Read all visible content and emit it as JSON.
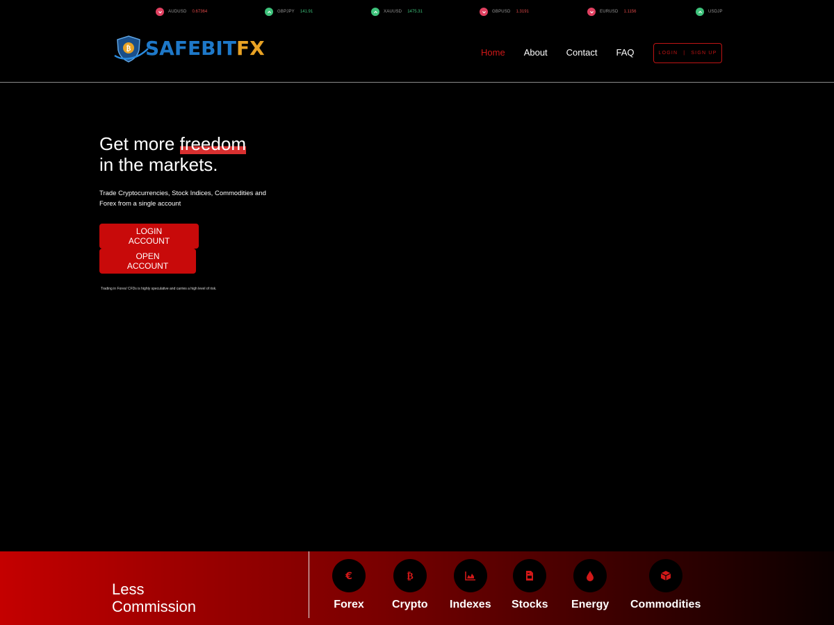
{
  "ticker": [
    {
      "symbol": "AUDUSD",
      "value": "0.67364",
      "direction": "down"
    },
    {
      "symbol": "GBPJPY",
      "value": "141.91",
      "direction": "up"
    },
    {
      "symbol": "XAUUSD",
      "value": "1475.31",
      "direction": "up"
    },
    {
      "symbol": "GBPUSD",
      "value": "1.3191",
      "direction": "down"
    },
    {
      "symbol": "EURUSD",
      "value": "1.1156",
      "direction": "down"
    },
    {
      "symbol": "USDJP",
      "value": "",
      "direction": "up"
    }
  ],
  "header": {
    "logo_part1": "SAFEBIT",
    "logo_part2": "FX",
    "nav": [
      {
        "label": "Home",
        "active": true
      },
      {
        "label": "About",
        "active": false
      },
      {
        "label": "Contact",
        "active": false
      },
      {
        "label": "FAQ",
        "active": false
      }
    ],
    "login_label": "LOGIN",
    "separator": "|",
    "signup_label": "SIGN UP"
  },
  "hero": {
    "title_part1": "Get more ",
    "title_highlight": "freedom",
    "title_part2": "in the markets.",
    "subtitle": "Trade Cryptocurrencies, Stock Indices, Commodities and Forex from a single account",
    "login_button": "LOGIN ACCOUNT",
    "open_button": "OPEN ACCOUNT",
    "disclaimer": "Trading in Forex/ CFDs is highly speculative and carries a high level of risk."
  },
  "band": {
    "title_line1": "Less",
    "title_line2": "Commission",
    "markets": [
      {
        "label": "Forex",
        "icon": "euro-icon"
      },
      {
        "label": "Crypto",
        "icon": "bitcoin-icon"
      },
      {
        "label": "Indexes",
        "icon": "chart-area-icon"
      },
      {
        "label": "Stocks",
        "icon": "file-invoice-icon"
      },
      {
        "label": "Energy",
        "icon": "drop-icon"
      },
      {
        "label": "Commodities",
        "icon": "cube-icon"
      }
    ]
  },
  "colors": {
    "accent": "#c80a0a",
    "up": "#3ec27b",
    "down": "#e04848",
    "logo_blue": "#1e78c8",
    "logo_gold": "#e8a224"
  }
}
